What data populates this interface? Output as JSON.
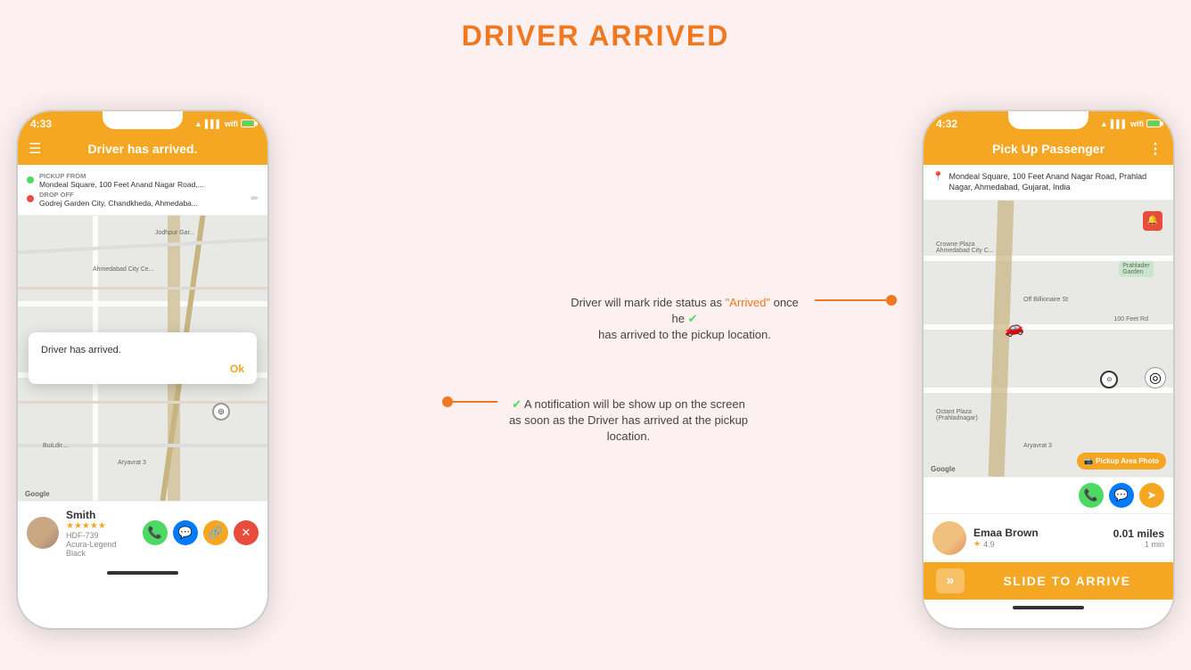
{
  "page": {
    "title": "DRIVER ARRIVED",
    "background": "#fdf0f0"
  },
  "left_phone": {
    "status_bar": {
      "time": "4:33",
      "icons": [
        "location",
        "signal",
        "wifi",
        "battery"
      ]
    },
    "header": {
      "menu_icon": "☰",
      "title": "Driver has arrived."
    },
    "route": {
      "pickup_label": "PICKUP FROM",
      "pickup_address": "Mondeal Square, 100 Feet Anand Nagar Road,...",
      "dropoff_label": "DROP OFF",
      "dropoff_address": "Godrej Garden City, Chandkheda, Ahmedaba..."
    },
    "notification": {
      "text": "Driver has arrived.",
      "ok_label": "Ok"
    },
    "driver": {
      "name": "Smith",
      "vehicle": "HDF-739",
      "car_model": "Acura-Legend Black",
      "rating": "★★★★★"
    },
    "action_icons": {
      "call": "📞",
      "chat": "💬",
      "share": "🔗",
      "cancel": "✕"
    }
  },
  "right_phone": {
    "status_bar": {
      "time": "4:32",
      "icons": [
        "location",
        "signal",
        "wifi",
        "battery"
      ]
    },
    "header": {
      "title": "Pick Up Passenger",
      "menu_icon": "⋮"
    },
    "pickup_address": "Mondeal Square, 100 Feet Anand Nagar Road, Prahlad Nagar, Ahmedabad, Gujarat, India",
    "pickup_area_btn": "Pickup Area Photo",
    "passenger": {
      "name": "Emaa Brown",
      "rating": "4.9",
      "distance": "0.01 miles",
      "time": "1 min"
    },
    "slide_btn": {
      "label": "SLIDE TO ARRIVE",
      "arrow": "»"
    }
  },
  "annotations": {
    "top": {
      "text": "Driver will mark ride status as \"Arrived\" once he has arrived to the pickup location.",
      "highlight": "\"Arrived\""
    },
    "bottom": {
      "text": "A notification will be show up on the screen as soon as the Driver has arrived at the pickup location."
    }
  }
}
